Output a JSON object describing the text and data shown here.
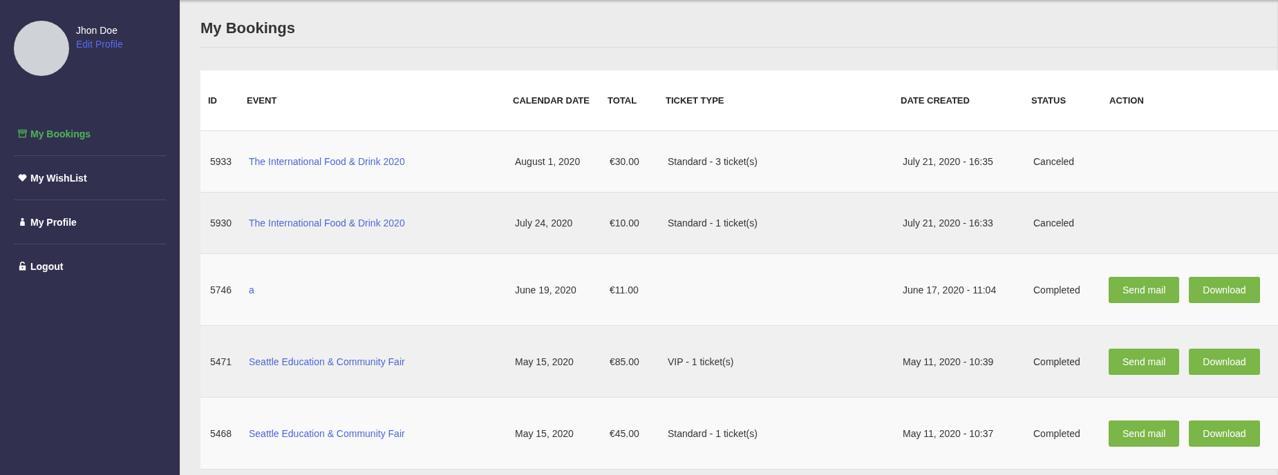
{
  "user": {
    "name": "Jhon Doe",
    "edit_link": "Edit Profile"
  },
  "sidebar": {
    "items": [
      {
        "label": "My Bookings",
        "kind": "archive",
        "selected": true
      },
      {
        "label": "My WishList",
        "kind": "heart",
        "selected": false
      },
      {
        "label": "My Profile",
        "kind": "user",
        "selected": false
      },
      {
        "label": "Logout",
        "kind": "lock",
        "selected": false
      }
    ]
  },
  "page_title": "My Bookings",
  "table": {
    "columns": [
      "ID",
      "EVENT",
      "CALENDAR DATE",
      "TOTAL",
      "TICKET TYPE",
      "DATE CREATED",
      "STATUS",
      "ACTION"
    ],
    "rows": [
      {
        "id": "5933",
        "event": "The International Food & Drink 2020",
        "calendar_date": "August 1, 2020",
        "total": "€30.00",
        "ticket_type": "Standard - 3 ticket(s)",
        "date_created": "July 21, 2020 - 16:35",
        "status": "Canceled",
        "actions": []
      },
      {
        "id": "5930",
        "event": "The International Food & Drink 2020",
        "calendar_date": "July 24, 2020",
        "total": "€10.00",
        "ticket_type": "Standard - 1 ticket(s)",
        "date_created": "July 21, 2020 - 16:33",
        "status": "Canceled",
        "actions": []
      },
      {
        "id": "5746",
        "event": "a",
        "calendar_date": "June 19, 2020",
        "total": "€11.00",
        "date_created": "June 17, 2020 - 11:04",
        "status": "Completed",
        "actions": [
          "Send mail",
          "Download"
        ]
      },
      {
        "id": "5471",
        "event": "Seattle Education & Community Fair",
        "calendar_date": "May 15, 2020",
        "total": "€85.00",
        "ticket_type": "VIP - 1 ticket(s)",
        "date_created": "May 11, 2020 - 10:39",
        "status": "Completed",
        "actions": [
          "Send mail",
          "Download"
        ]
      },
      {
        "id": "5468",
        "event": "Seattle Education & Community Fair",
        "calendar_date": "May 15, 2020",
        "total": "€45.00",
        "ticket_type": "Standard - 1 ticket(s)",
        "date_created": "May 11, 2020 - 10:37",
        "status": "Completed",
        "actions": [
          "Send mail",
          "Download"
        ]
      }
    ]
  }
}
